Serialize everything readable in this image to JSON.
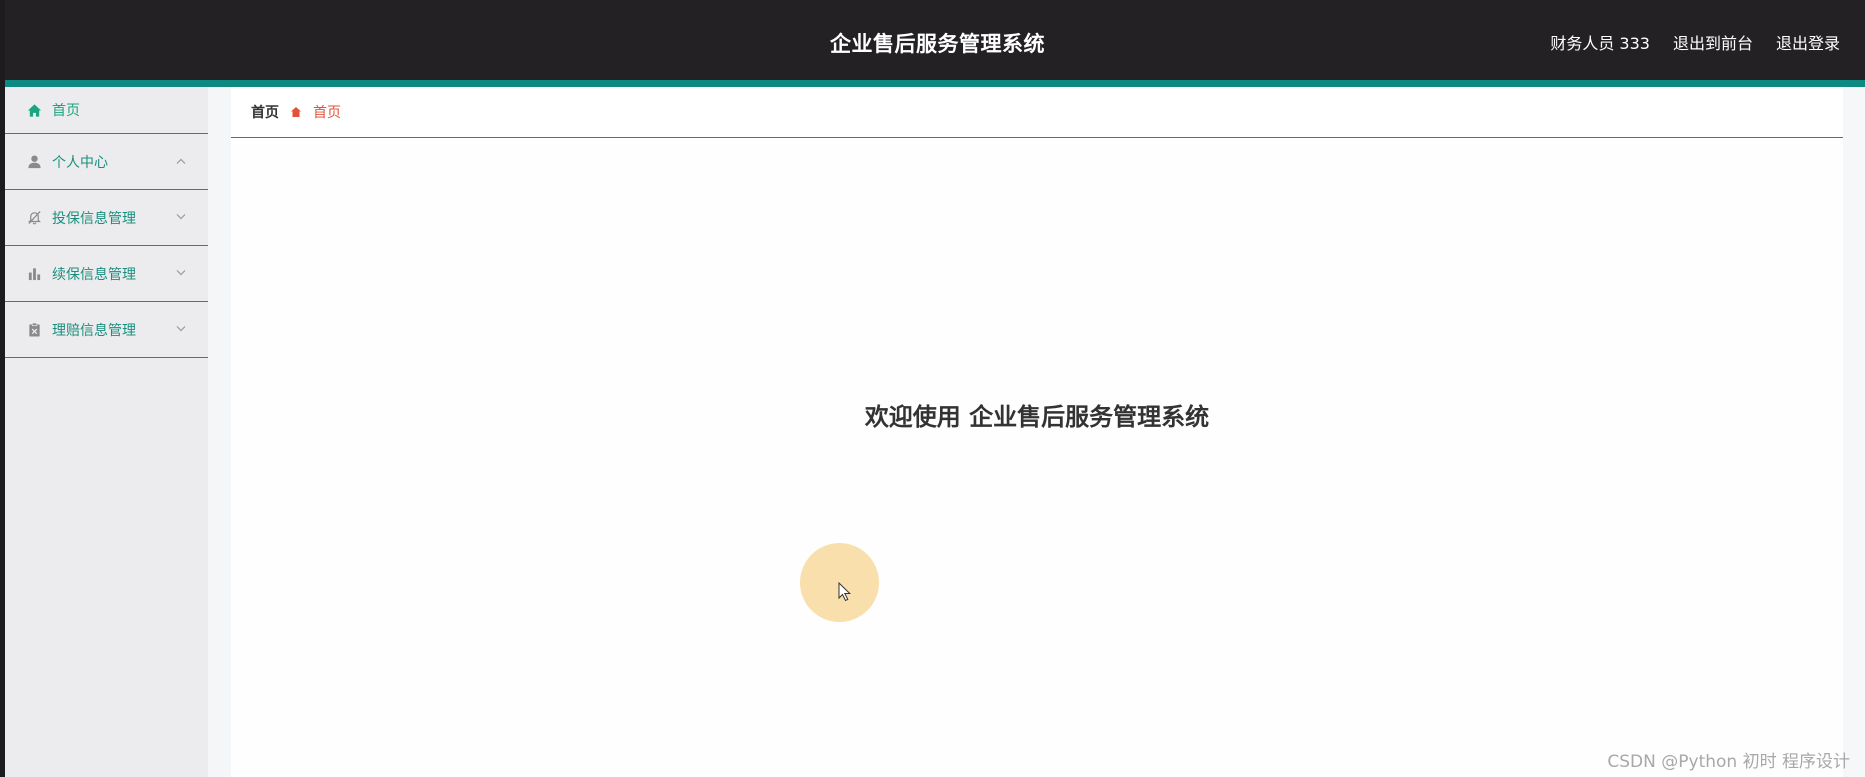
{
  "app": {
    "title": "企业售后服务管理系统"
  },
  "header": {
    "user_label": "财务人员 333",
    "back_to_front": "退出到前台",
    "logout": "退出登录"
  },
  "sidebar": {
    "items": [
      {
        "label": "首页",
        "icon": "home-icon",
        "expandable": false
      },
      {
        "label": "个人中心",
        "icon": "user-icon",
        "expandable": true,
        "expanded": true
      },
      {
        "label": "投保信息管理",
        "icon": "bell-off-icon",
        "expandable": true,
        "expanded": false
      },
      {
        "label": "续保信息管理",
        "icon": "bar-chart-icon",
        "expandable": true,
        "expanded": false
      },
      {
        "label": "理赔信息管理",
        "icon": "clipboard-icon",
        "expandable": true,
        "expanded": false
      }
    ]
  },
  "breadcrumb": {
    "root": "首页",
    "current": "首页"
  },
  "main": {
    "welcome": "欢迎使用 企业售后服务管理系统"
  },
  "watermark": "CSDN @Python 初时 程序设计",
  "colors": {
    "header_bg": "#232124",
    "accent_teal": "#0e8a80",
    "sidebar_bg": "#ececee",
    "breadcrumb_current": "#e4523b"
  }
}
